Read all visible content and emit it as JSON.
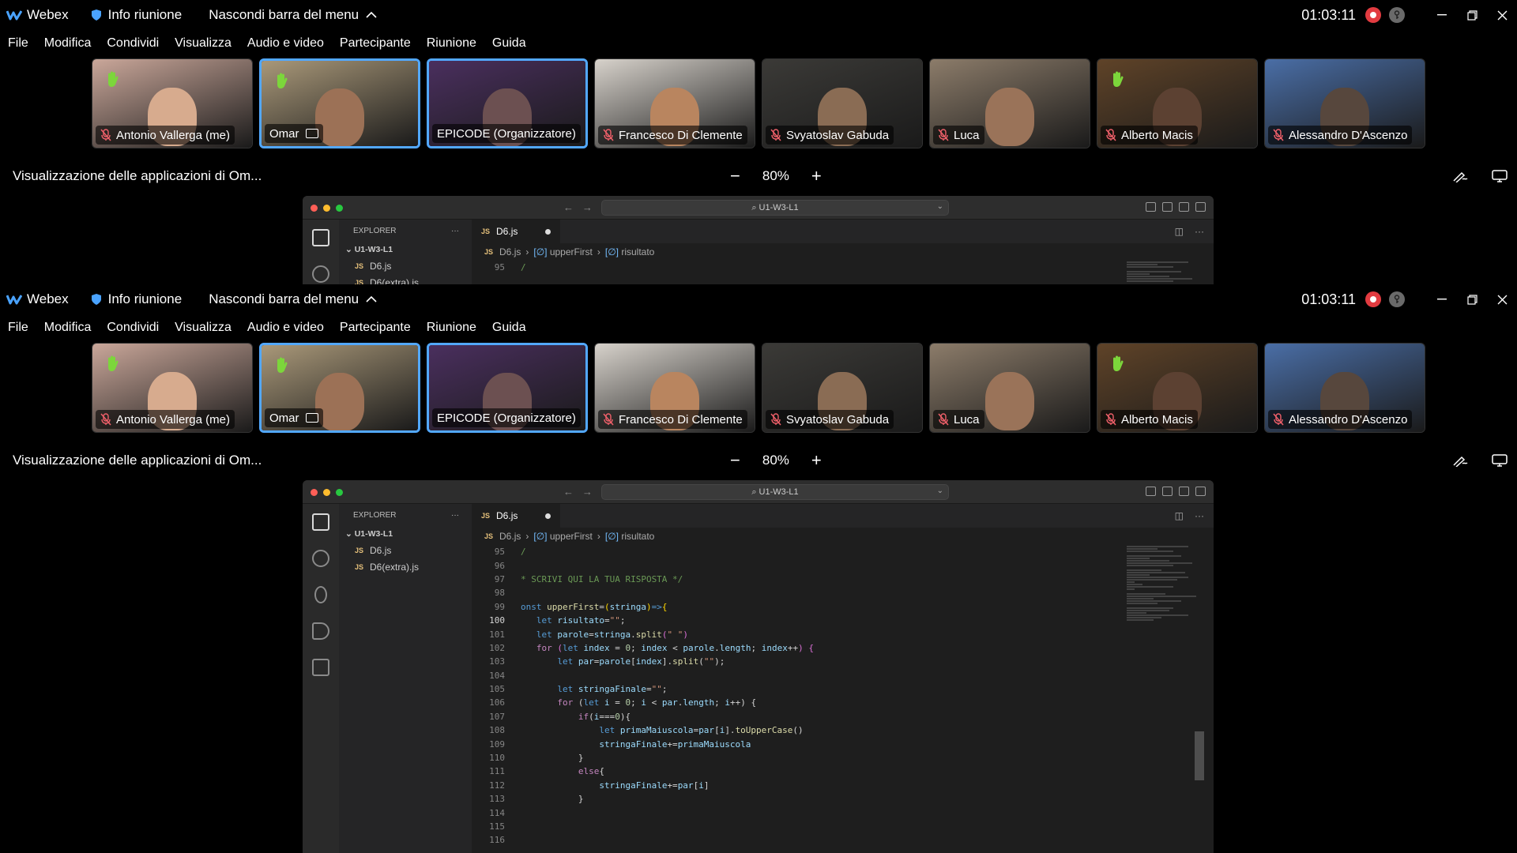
{
  "app": {
    "name": "Webex",
    "info_label": "Info riunione",
    "hide_menu_label": "Nascondi barra del menu",
    "timer": "01:03:11"
  },
  "menu": [
    "File",
    "Modifica",
    "Condividi",
    "Visualizza",
    "Audio e video",
    "Partecipante",
    "Riunione",
    "Guida"
  ],
  "participants": [
    {
      "name": "Antonio Vallerga (me)",
      "muted": true,
      "hand_raised": true,
      "active": false,
      "bg": "#caa79a",
      "face": "#d7ab8e"
    },
    {
      "name": "Omar",
      "muted": false,
      "hand_raised": true,
      "active": true,
      "sharing": true,
      "bg": "#a99879",
      "face": "#9c7156"
    },
    {
      "name": "EPICODE (Organizzatore)",
      "muted": false,
      "hand_raised": false,
      "active": true,
      "bg": "#4a2f5e",
      "face": "#6c5051"
    },
    {
      "name": "Francesco Di Clemente",
      "muted": true,
      "hand_raised": false,
      "active": false,
      "bg": "#d7d2cb",
      "face": "#b9855f"
    },
    {
      "name": "Svyatoslav Gabuda",
      "muted": true,
      "hand_raised": false,
      "active": false,
      "bg": "#3b3a37",
      "face": "#8a6c54"
    },
    {
      "name": "Luca",
      "muted": true,
      "hand_raised": false,
      "active": false,
      "bg": "#8c7c6a",
      "face": "#9a7359"
    },
    {
      "name": "Alberto Macis",
      "muted": true,
      "hand_raised": true,
      "active": false,
      "bg": "#5f4328",
      "face": "#5c4132"
    },
    {
      "name": "Alessandro D'Ascenzo",
      "muted": true,
      "hand_raised": false,
      "active": false,
      "bg": "#4a6ea6",
      "face": "#57473d"
    }
  ],
  "share": {
    "title": "Visualizzazione delle applicazioni di Om...",
    "zoom": "80%",
    "minus": "−",
    "plus": "+"
  },
  "vscode": {
    "search": "U1-W3-L1",
    "explorer_label": "EXPLORER",
    "explorer_more": "···",
    "folder": "U1-W3-L1",
    "files": [
      "D6.js",
      "D6(extra).js"
    ],
    "js_tag": "JS",
    "tab": "D6.js",
    "breadcrumb": [
      "D6.js",
      "upperFirst",
      "risultato"
    ],
    "bc_sym": "[∅]",
    "lines": [
      {
        "n": "95",
        "html": "<span class=\"cm\">/</span>"
      },
      {
        "n": "96",
        "html": ""
      },
      {
        "n": "97",
        "html": "<span class=\"cm\">* SCRIVI QUI LA TUA RISPOSTA */</span>"
      },
      {
        "n": "98",
        "html": ""
      },
      {
        "n": "99",
        "html": "<span class=\"kw\">onst</span> <span class=\"fn\">upperFirst</span>=<span class=\"br\">(</span><span class=\"var\">stringa</span><span class=\"br\">)</span><span class=\"kw\">=&gt;</span><span class=\"br\">{</span>"
      },
      {
        "n": "100",
        "cur": true,
        "html": "   <span class=\"kw\">let</span> <span class=\"var\">risultato</span>=<span class=\"str\">\"\"</span>;"
      },
      {
        "n": "101",
        "html": "   <span class=\"kw\">let</span> <span class=\"var\">parole</span>=<span class=\"var\">stringa</span>.<span class=\"fn\">split</span><span class=\"br2\">(</span><span class=\"str\">\" \"</span><span class=\"br2\">)</span>"
      },
      {
        "n": "102",
        "html": "   <span class=\"ctrl\">for</span> <span class=\"br2\">(</span><span class=\"kw\">let</span> <span class=\"var\">index</span> = <span class=\"num\">0</span>; <span class=\"var\">index</span> &lt; <span class=\"var\">parole</span>.<span class=\"var\">length</span>; <span class=\"var\">index</span>++<span class=\"br2\">)</span> <span class=\"br2\">{</span>"
      },
      {
        "n": "103",
        "html": "       <span class=\"kw\">let</span> <span class=\"var\">par</span>=<span class=\"var\">parole</span>[<span class=\"var\">index</span>].<span class=\"fn\">split</span>(<span class=\"str\">\"\"</span>);"
      },
      {
        "n": "104",
        "html": ""
      },
      {
        "n": "105",
        "html": "       <span class=\"kw\">let</span> <span class=\"var\">stringaFinale</span>=<span class=\"str\">\"\"</span>;"
      },
      {
        "n": "106",
        "html": "       <span class=\"ctrl\">for</span> (<span class=\"kw\">let</span> <span class=\"var\">i</span> = <span class=\"num\">0</span>; <span class=\"var\">i</span> &lt; <span class=\"var\">par</span>.<span class=\"var\">length</span>; <span class=\"var\">i</span>++) {"
      },
      {
        "n": "107",
        "html": "           <span class=\"ctrl\">if</span>(<span class=\"var\">i</span>===<span class=\"num\">0</span>){"
      },
      {
        "n": "108",
        "html": "               <span class=\"kw\">let</span> <span class=\"var\">primaMaiuscola</span>=<span class=\"var\">par</span>[<span class=\"var\">i</span>].<span class=\"fn\">toUpperCase</span>()"
      },
      {
        "n": "109",
        "html": "               <span class=\"var\">stringaFinale</span>+=<span class=\"var\">primaMaiuscola</span>"
      },
      {
        "n": "110",
        "html": "           }"
      },
      {
        "n": "111",
        "html": "           <span class=\"ctrl\">else</span>{"
      },
      {
        "n": "112",
        "html": "               <span class=\"var\">stringaFinale</span>+=<span class=\"var\">par</span>[<span class=\"var\">i</span>]"
      },
      {
        "n": "113",
        "html": "           }"
      },
      {
        "n": "114",
        "html": ""
      },
      {
        "n": "115",
        "html": ""
      },
      {
        "n": "116",
        "html": ""
      }
    ]
  },
  "colors": {
    "accent": "#52a8ff",
    "record": "#e23b40",
    "hand": "#7cd63b"
  }
}
